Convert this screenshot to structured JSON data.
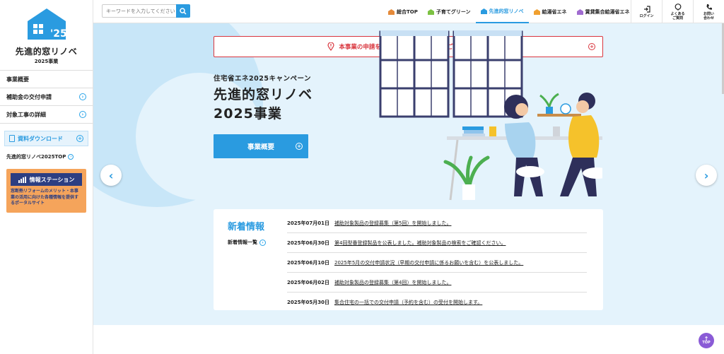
{
  "sidebar": {
    "logo_year": "'25",
    "logo_title": "先進的窓リノベ",
    "logo_sub": "2025事業",
    "items": [
      {
        "label": "事業概要"
      },
      {
        "label": "補助金の交付申請"
      },
      {
        "label": "対象工事の詳細"
      }
    ],
    "download_label": "資料ダウンロード",
    "top_link": "先進的窓リノベ2025TOP",
    "station_title": "情報ステーション",
    "station_text": "窓断熱リフォームのメリット・本事業の活用に向けた各種情報を提供するポータルサイト"
  },
  "header": {
    "search_placeholder": "キーワードを入力してください",
    "nav": [
      {
        "label": "総合TOP",
        "color": "#e58a3a"
      },
      {
        "label": "子育てグリーン",
        "color": "#7cc142"
      },
      {
        "label": "先進的窓リノベ",
        "color": "#2a9be0"
      },
      {
        "label": "給湯省エネ",
        "color": "#f0a030"
      },
      {
        "label": "賃貸集合給湯省エネ",
        "color": "#a06bd0"
      }
    ],
    "util": {
      "login": "ログイン",
      "faq_1": "よくある",
      "faq_2": "ご質問",
      "contact_1": "お問い",
      "contact_2": "合わせ"
    }
  },
  "hero": {
    "notice": "本事業の申請を検討されている方は必ずご確認ください",
    "subtitle": "住宅省エネ2025キャンペーン",
    "title_line1": "先進的窓リノベ",
    "title_line2": "2025事業",
    "button": "事業概要"
  },
  "news": {
    "title": "新着情報",
    "more": "新着情報一覧",
    "items": [
      {
        "date": "2025年07月01日",
        "text": "補助対象製品の登録募集（第5回）を開始しました。"
      },
      {
        "date": "2025年06月30日",
        "text": "第4回型番登録製品を公表しました。補助対象製品の検索をご確認ください。"
      },
      {
        "date": "2025年06月10日",
        "text": "2025年5月の交付申請状況（早期の交付申請に係るお願いを含む）を公表しました。"
      },
      {
        "date": "2025年06月02日",
        "text": "補助対象製品の登録募集（第4回）を開始しました。"
      },
      {
        "date": "2025年05月30日",
        "text": "集合住宅の一括での交付申請（予約を含む）の受付を開始します。"
      }
    ]
  },
  "page_top": "TOP",
  "colors": {
    "accent": "#2a9be0",
    "notice": "#d9363e",
    "station": "#f5a45b",
    "navy": "#2c3e82"
  }
}
